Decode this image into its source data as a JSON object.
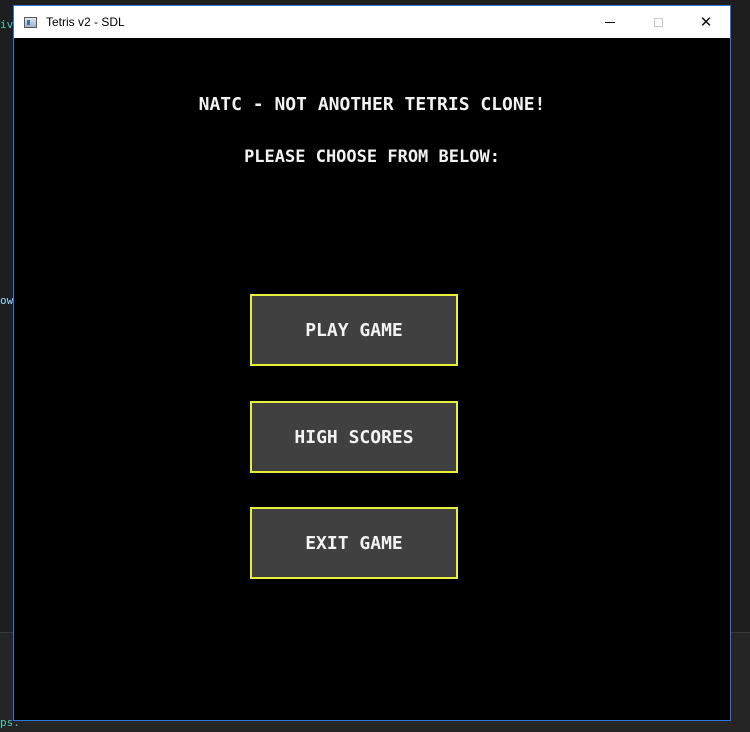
{
  "background": {
    "fragment_top": "iv",
    "fragment_mid": "ow",
    "fragment_bottom": "ps."
  },
  "window": {
    "title": "Tetris v2 - SDL",
    "icon": "app-window-icon",
    "controls": {
      "minimize": "minimize-icon",
      "maximize": "maximize-icon",
      "close_glyph": "✕"
    }
  },
  "menu": {
    "headline": "NATC - NOT ANOTHER TETRIS CLONE!",
    "subline": "PLEASE CHOOSE FROM BELOW:",
    "buttons": [
      {
        "label": "PLAY GAME"
      },
      {
        "label": "HIGH SCORES"
      },
      {
        "label": "EXIT GAME"
      }
    ]
  },
  "colors": {
    "canvas_bg": "#000000",
    "button_bg": "#404040",
    "button_border": "#e6f03a",
    "text": "#f2f2f2",
    "window_border": "#2b78e4"
  }
}
